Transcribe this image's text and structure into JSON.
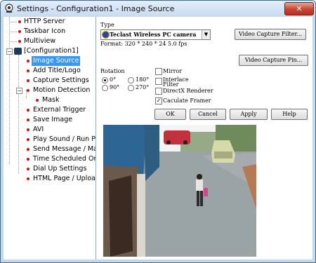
{
  "window": {
    "title": "Settings - Configuration1 - Image Source",
    "close_label": "✕"
  },
  "tree": {
    "items": [
      {
        "label": "HTTP Server"
      },
      {
        "label": "Taskbar Icon"
      },
      {
        "label": "Multiview"
      },
      {
        "label": "[Configuration1]"
      },
      {
        "label": "Image Source",
        "selected": true
      },
      {
        "label": "Add Title/Logo"
      },
      {
        "label": "Capture Settings"
      },
      {
        "label": "Motion Detection"
      },
      {
        "label": "Mask"
      },
      {
        "label": "External Trigger"
      },
      {
        "label": "Save Image"
      },
      {
        "label": "AVI"
      },
      {
        "label": "Play Sound / Run Prc"
      },
      {
        "label": "Send Message / Mai"
      },
      {
        "label": "Time Scheduled On/C"
      },
      {
        "label": "Dial Up Settings"
      },
      {
        "label": "HTML Page / Upload"
      }
    ]
  },
  "source": {
    "type_label": "Type",
    "device": "Teclast Wireless PC camera",
    "format": "Format: 320 * 240 * 24    5.0 fps",
    "video_filter_button": "Video Capture Filter...",
    "video_pin_button": "Video Capture Pin..."
  },
  "rotation": {
    "label": "Rotation",
    "options": [
      "0°",
      "180°",
      "90°",
      "270°"
    ],
    "selected": "0°"
  },
  "options": {
    "mirror": "Mirror",
    "interlace": "Interlace Filter",
    "directx": "DirectX Renderer",
    "framerate": "Caculate Framerate",
    "framerate_checked": true
  },
  "buttons": {
    "ok": "OK",
    "cancel": "Cancel",
    "apply": "Apply",
    "help": "Help"
  },
  "colors": {
    "selection": "#3399ff",
    "bullet": "#cc1111",
    "window_frame": "#c4d8ec"
  }
}
